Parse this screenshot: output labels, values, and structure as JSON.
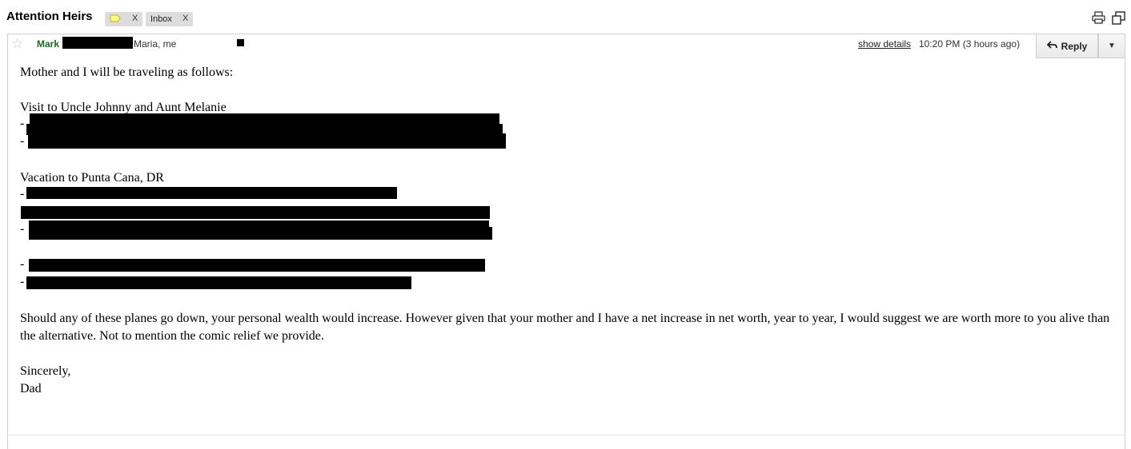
{
  "thread": {
    "subject": "Attention Heirs",
    "labels": [
      {
        "name": "",
        "color": "#ffff88",
        "remove": "X"
      },
      {
        "name": "Inbox",
        "remove": "X"
      }
    ]
  },
  "message": {
    "sender": "Mark",
    "recipients": "Maria, me",
    "show_details": "show details",
    "time": "10:20 PM (3 hours ago)",
    "reply_label": "Reply",
    "more_label": "▼",
    "body": {
      "greeting": "Mother and I will be traveling as follows:",
      "trip1_title": "Visit to Uncle Johnny and Aunt Melanie",
      "trip2_title": "Vacation to Punta Cana, DR",
      "dash": "-",
      "closing_paragraph": "Should any of these planes go down, your personal wealth would increase.  However given that your mother and I have a net increase in net worth, year to year, I would suggest we are worth more to you alive than the alternative.  Not to mention the comic relief we provide.",
      "signoff": "Sincerely,",
      "signature": "Dad"
    }
  },
  "colors": {
    "sender": "#1a6d22",
    "label_yellow": "#ffff88",
    "chip_bg": "#dddddd"
  }
}
